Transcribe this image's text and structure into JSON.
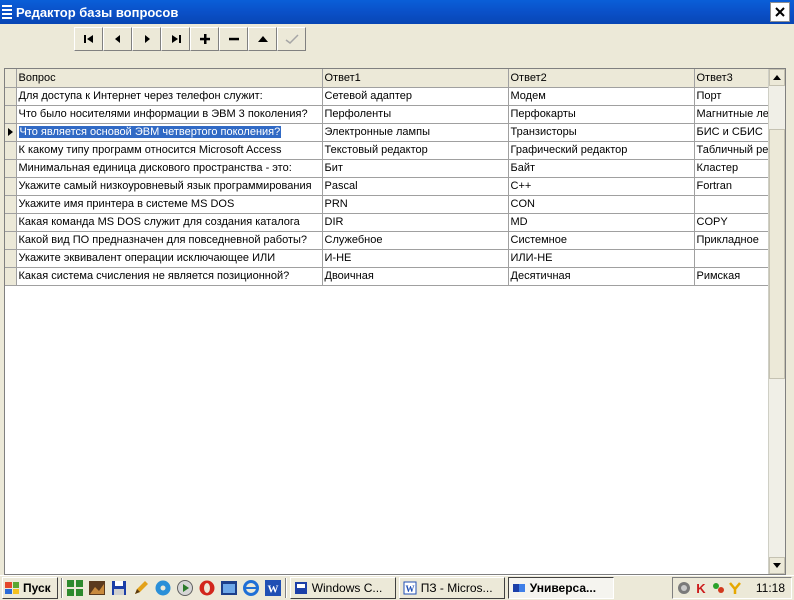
{
  "window": {
    "title": "Редактор базы вопросов"
  },
  "grid": {
    "columns": [
      "Вопрос",
      "Ответ1",
      "Ответ2",
      "Ответ3"
    ],
    "rows": [
      [
        "Для доступа к Интернет через телефон служит:",
        "Сетевой адаптер",
        "Модем",
        "Порт"
      ],
      [
        "Что было носителями информации в ЭВМ 3 поколения?",
        "Перфоленты",
        "Перфокарты",
        "Магнитные лен"
      ],
      [
        "Что является основой ЭВМ четвертого поколения?",
        "Электронные лампы",
        "Транзисторы",
        "БИС и СБИС"
      ],
      [
        "К какому типу программ относится Microsoft Access",
        "Текстовый редактор",
        "Графический редактор",
        "Табличный ред"
      ],
      [
        "Минимальная единица дискового пространства - это:",
        "Бит",
        "Байт",
        "Кластер"
      ],
      [
        "Укажите самый низкоуровневый язык программирования",
        "Pascal",
        "C++",
        "Fortran"
      ],
      [
        "Укажите имя принтера в системе MS DOS",
        "PRN",
        "CON",
        ""
      ],
      [
        "Какая команда MS DOS служит для создания каталога",
        "DIR",
        "MD",
        "COPY"
      ],
      [
        "Какой вид ПО предназначен для повседневной работы?",
        "Служебное",
        "Системное",
        "Прикладное"
      ],
      [
        "Укажите эквивалент операции исключающее ИЛИ",
        "И-НЕ",
        "ИЛИ-НЕ",
        ""
      ],
      [
        "Какая система счисления не является позиционной?",
        "Двоичная",
        "Десятичная",
        "Римская"
      ]
    ],
    "selected_row": 2
  },
  "taskbar": {
    "start_label": "Пуск",
    "tasks": [
      {
        "label": "Windows C...",
        "active": false
      },
      {
        "label": "ПЗ - Micros...",
        "active": false
      },
      {
        "label": "Универса...",
        "active": true
      }
    ],
    "clock": "11:18"
  },
  "colors": {
    "titlebar": "#0a50c8",
    "selection": "#316ac5",
    "face": "#ece9d8"
  }
}
